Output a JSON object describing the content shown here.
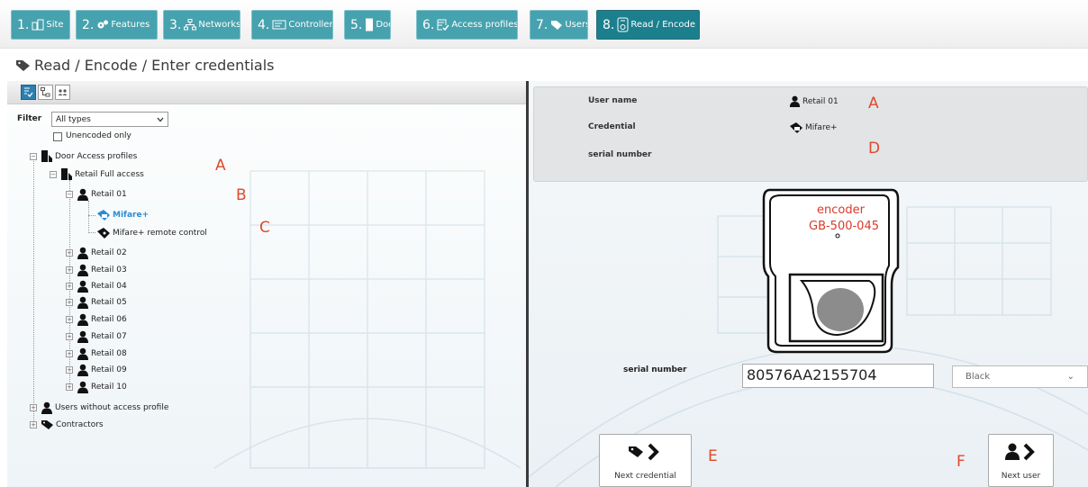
{
  "nav": {
    "tabs": [
      {
        "num": "1.",
        "label": "Site"
      },
      {
        "num": "2.",
        "label": "Features"
      },
      {
        "num": "3.",
        "label": "Networks"
      },
      {
        "num": "4.",
        "label": "Controllers"
      },
      {
        "num": "5.",
        "label": "Doors"
      },
      {
        "num": "6.",
        "label": "Access profiles"
      },
      {
        "num": "7.",
        "label": "Users"
      },
      {
        "num": "8.",
        "label": "Read / Encode"
      }
    ]
  },
  "page": {
    "title": "Read / Encode / Enter credentials"
  },
  "filter": {
    "label": "Filter",
    "selected": "All types",
    "unencoded_label": "Unencoded only"
  },
  "tree": {
    "root": "Door Access profiles",
    "profile": "Retail Full access",
    "user_open": "Retail 01",
    "credential_selected": "Mifare+",
    "credential_2": "Mifare+ remote control",
    "users": [
      "Retail 02",
      "Retail 03",
      "Retail 04",
      "Retail 05",
      "Retail 06",
      "Retail 07",
      "Retail 08",
      "Retail 09",
      "Retail 10"
    ],
    "no_profile": "Users without access profile",
    "contractors": "Contractors"
  },
  "annotations": {
    "a1": "A",
    "b": "B",
    "c": "C",
    "a2": "A",
    "d": "D",
    "e": "E",
    "f": "F"
  },
  "info": {
    "user_name_label": "User name",
    "user_name_value": "Retail 01",
    "credential_label": "Credential",
    "credential_value": "Mifare+",
    "serial_label": "serial number"
  },
  "encoder": {
    "line1": "encoder",
    "line2": "GB-500-045"
  },
  "serial": {
    "label": "serial number",
    "value": "80576AA2155704"
  },
  "color_select": {
    "value": "Black"
  },
  "buttons": {
    "next_credential": "Next credential",
    "next_user": "Next user"
  },
  "colors": {
    "tab": "#46a2ae",
    "tab_active": "#1b7f8e",
    "annotation": "#e04a2a",
    "selected": "#2a8bd4"
  }
}
